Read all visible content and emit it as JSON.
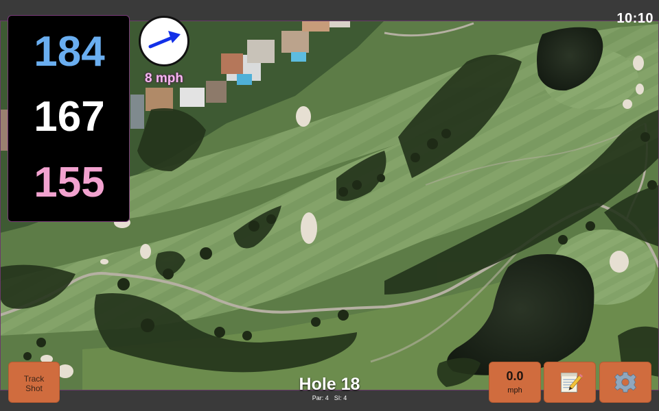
{
  "status_bar": {
    "time": "10:10"
  },
  "distances": {
    "back": "184",
    "middle": "167",
    "front": "155"
  },
  "wind": {
    "speed_text": "8 mph",
    "direction_icon": "arrow-icon"
  },
  "buttons": {
    "track_shot_label": "Track\nShot",
    "shot_speed_value": "0.0",
    "shot_speed_unit": "mph",
    "notes_icon": "notepad-icon",
    "settings_icon": "gear-icon"
  },
  "hole": {
    "title": "Hole 18",
    "par": "Par: 4",
    "si": "SI: 4"
  },
  "colors": {
    "back_distance": "#6aaef0",
    "middle_distance": "#ffffff",
    "front_distance": "#f2a2cf",
    "button": "#d06c3e",
    "fairway": "#7a9a62",
    "rough": "#5f7f4a"
  }
}
